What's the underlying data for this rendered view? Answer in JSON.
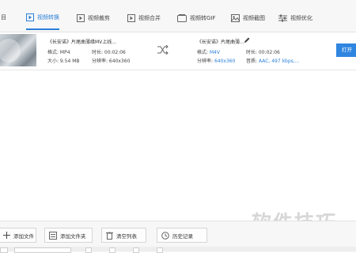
{
  "tabs": {
    "cut_label": "目",
    "items": [
      {
        "label": "视频转换",
        "icon": "video-convert-icon",
        "active": true
      },
      {
        "label": "视频裁剪",
        "icon": "video-crop-icon",
        "active": false
      },
      {
        "label": "视频合并",
        "icon": "video-merge-icon",
        "active": false
      },
      {
        "label": "视频转GIF",
        "icon": "gif-icon",
        "active": false
      },
      {
        "label": "视频截图",
        "icon": "screenshot-icon",
        "active": false
      },
      {
        "label": "视频优化",
        "icon": "optimize-icon",
        "active": false
      }
    ]
  },
  "file": {
    "source": {
      "title": "《长安诺》片尾曲薄缘MV上线...",
      "format_label": "格式: MP4",
      "duration_label": "时长: 00:02:06",
      "size_label": "大小: 9.54 MB",
      "resolution_label": "分辨率: 640x360"
    },
    "output": {
      "title": "《长安诺》片尾曲薄...",
      "format_prefix": "格式: ",
      "format_value": "M4V",
      "duration_label": "时长: 00:02:06",
      "resolution_prefix": "分辨率: ",
      "resolution_value": "640x360",
      "quality_prefix": "音质: ",
      "quality_value": "AAC, 497 kbps,..."
    },
    "open_button": "打开"
  },
  "toolbar": {
    "add_file": "添加文件",
    "add_folder": "添加文件夹",
    "clear_list": "清空列表",
    "history": "历史记录"
  },
  "watermark": "软件技巧",
  "colors": {
    "accent": "#2a7fd8",
    "button": "#2f86e0"
  }
}
